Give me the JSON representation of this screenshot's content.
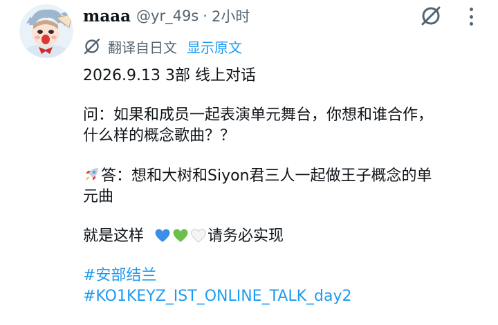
{
  "tweet": {
    "display_name": "maaa",
    "handle": "@yr_49s",
    "separator": "·",
    "time": "2小时",
    "translate_label": "翻译自日文",
    "show_original": "显示原文",
    "lines": {
      "date_line": "2026.9.13 3部 线上对话",
      "question_1": "问：如果和成员一起表演单元舞台，你想和谁合作，",
      "question_2": "什么样的概念歌曲？？",
      "answer_1": "答：想和大树和Siyon君三人一起做王子概念的单",
      "answer_2": "元曲",
      "closing": "请务必实现"
    },
    "closing_prefix": "就是这样",
    "hashtags": [
      "#安部结兰",
      "#KO1KEYZ_IST_ONLINE_TALK_day2"
    ]
  },
  "icons": {
    "avatar": "cartoon-avatar",
    "grok": "grok-slash-circle-icon",
    "more": "vertical-ellipsis-icon",
    "translate": "grok-translate-icon",
    "rocket": "rocket-emoji",
    "hearts": [
      "blue-heart",
      "green-heart",
      "white-heart"
    ]
  },
  "colors": {
    "link": "#1d9bf0",
    "secondary_text": "#536471",
    "primary_text": "#0f1419"
  }
}
